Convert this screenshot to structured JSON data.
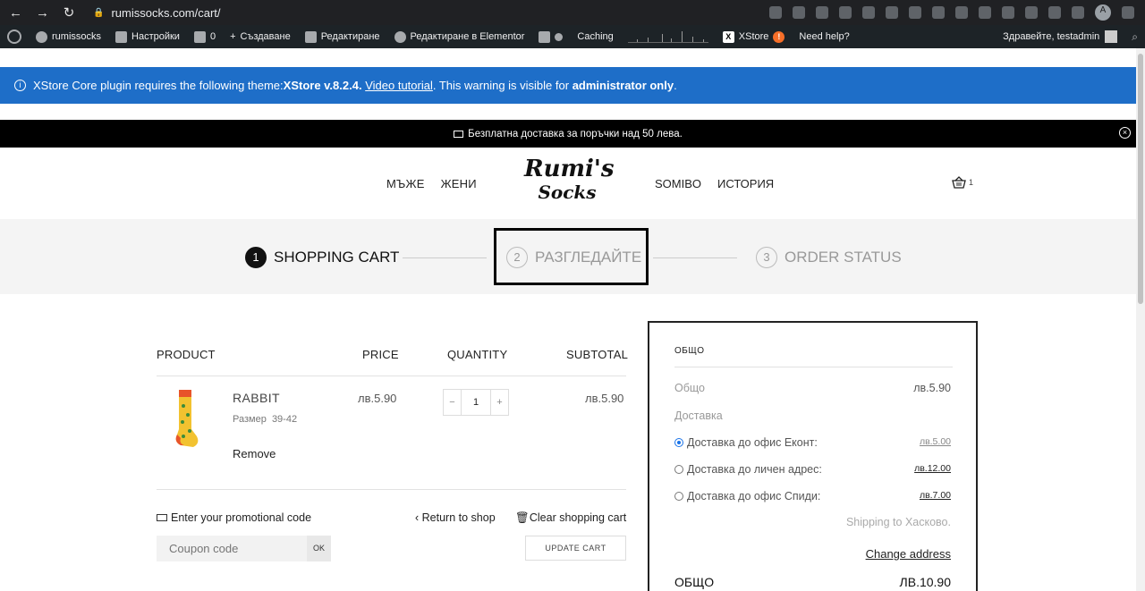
{
  "browser": {
    "url": "rumissocks.com/cart/",
    "profile_initial": "A"
  },
  "adminbar": {
    "site": "rumissocks",
    "customize": "Настройки",
    "comments": "0",
    "new": "Създаване",
    "edit": "Редактиране",
    "elementor": "Редактиране в Elementor",
    "caching": "Caching",
    "xstore": "XStore",
    "help": "Need help?",
    "greeting": "Здравейте, testadmin"
  },
  "notice": {
    "prefix": "XStore Core plugin requires the following theme: ",
    "theme": "XStore v.8.2.4.",
    "space": " ",
    "link": "Video tutorial",
    "suffix": ". This warning is visible for ",
    "audience": "administrator only",
    "end": "."
  },
  "promo": {
    "text": "Безплатна доставка за поръчки над 50 лева."
  },
  "header": {
    "menu_left": [
      "МЪЖЕ",
      "ЖЕНИ"
    ],
    "menu_right": [
      "SOMIBO",
      "ИСТОРИЯ"
    ],
    "logo_line1": "Rumi's",
    "logo_line2": "Socks",
    "cart_count": "1"
  },
  "steps": [
    {
      "num": "1",
      "label": "SHOPPING CART"
    },
    {
      "num": "2",
      "label": "РАЗГЛЕДАЙТЕ"
    },
    {
      "num": "3",
      "label": "ORDER STATUS"
    }
  ],
  "cart": {
    "headers": {
      "product": "PRODUCT",
      "price": "PRICE",
      "quantity": "QUANTITY",
      "subtotal": "SUBTOTAL"
    },
    "item": {
      "name": "RABBIT",
      "attr_label": "Размер",
      "attr_value": "39-42",
      "remove": "Remove",
      "price": "лв.5.90",
      "quantity": "1",
      "subtotal": "лв.5.90",
      "minus": "−",
      "plus": "+"
    },
    "promo_label": "Enter your promotional code",
    "coupon_placeholder": "Coupon code",
    "coupon_ok": "OK",
    "return_shop": "Return to shop",
    "clear_cart": "Clear shopping cart",
    "update_cart": "UPDATE CART"
  },
  "totals": {
    "title": "ОБЩО",
    "subtotal_label": "Общо",
    "subtotal_value": "лв.5.90",
    "shipping_label": "Доставка",
    "options": [
      {
        "label": "Доставка до офис Еконт:",
        "price": "лв.5.00",
        "selected": true
      },
      {
        "label": "Доставка до личен адрес:",
        "price": "лв.12.00",
        "selected": false
      },
      {
        "label": "Доставка до офис Спиди:",
        "price": "лв.7.00",
        "selected": false
      }
    ],
    "shipping_to": "Shipping to Хасково.",
    "change_address": "Change address",
    "total_label": "ОБЩО",
    "total_value": "ЛВ.10.90"
  }
}
